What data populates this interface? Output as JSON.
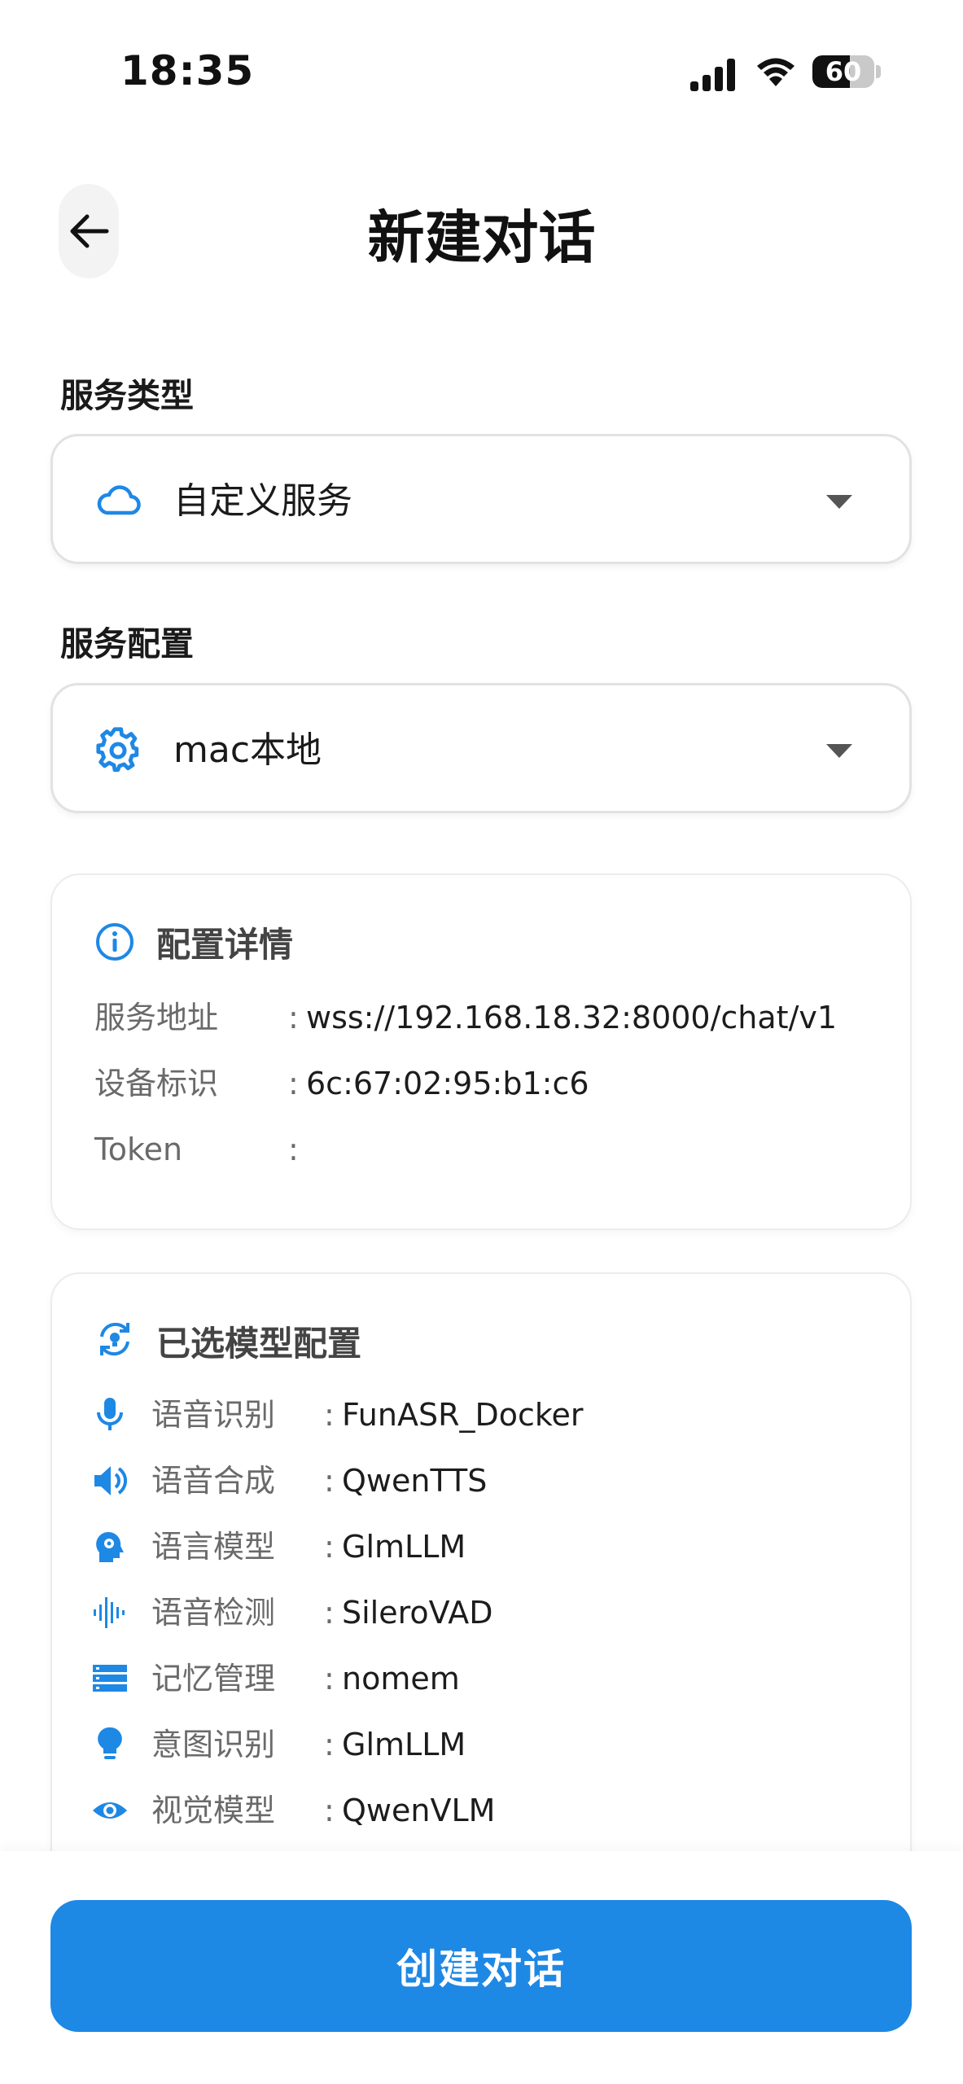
{
  "status_bar": {
    "time": "18:35",
    "battery": "60",
    "icons": [
      "signal-icon",
      "wifi-icon",
      "battery-icon"
    ]
  },
  "header": {
    "title": "新建对话",
    "back_icon": "arrow-left-icon"
  },
  "service_type": {
    "label": "服务类型",
    "value": "自定义服务",
    "icon": "cloud-icon"
  },
  "service_config": {
    "label": "服务配置",
    "value": "mac本地",
    "icon": "gear-icon"
  },
  "config_details": {
    "title": "配置详情",
    "icon": "info-icon",
    "rows": [
      {
        "key": "服务地址",
        "colon": ":",
        "value": "wss://192.168.18.32:8000/chat/v1"
      },
      {
        "key": "设备标识",
        "colon": ":",
        "value": "6c:67:02:95:b1:c6"
      },
      {
        "key": "Token",
        "colon": ":",
        "value": ""
      }
    ]
  },
  "selected_models": {
    "title": "已选模型配置",
    "icon": "sync-bulb-icon",
    "rows": [
      {
        "key": "语音识别",
        "colon": ":",
        "value": "FunASR_Docker",
        "icon": "microphone-icon"
      },
      {
        "key": "语音合成",
        "colon": ":",
        "value": "QwenTTS",
        "icon": "speaker-icon"
      },
      {
        "key": "语言模型",
        "colon": ":",
        "value": "GlmLLM",
        "icon": "head-gear-icon"
      },
      {
        "key": "语音检测",
        "colon": ":",
        "value": "SileroVAD",
        "icon": "waveform-icon"
      },
      {
        "key": "记忆管理",
        "colon": ":",
        "value": "nomem",
        "icon": "storage-icon"
      },
      {
        "key": "意图识别",
        "colon": ":",
        "value": "GlmLLM",
        "icon": "lightbulb-icon"
      },
      {
        "key": "视觉模型",
        "colon": ":",
        "value": "QwenVLM",
        "icon": "eye-icon"
      }
    ]
  },
  "actions": {
    "create_label": "创建对话"
  },
  "colors": {
    "accent": "#1e88e5",
    "icon_blue": "#1e88e5",
    "text_primary": "#1a1a1a",
    "text_secondary": "#6a6a6a",
    "card_border": "#ececec"
  }
}
